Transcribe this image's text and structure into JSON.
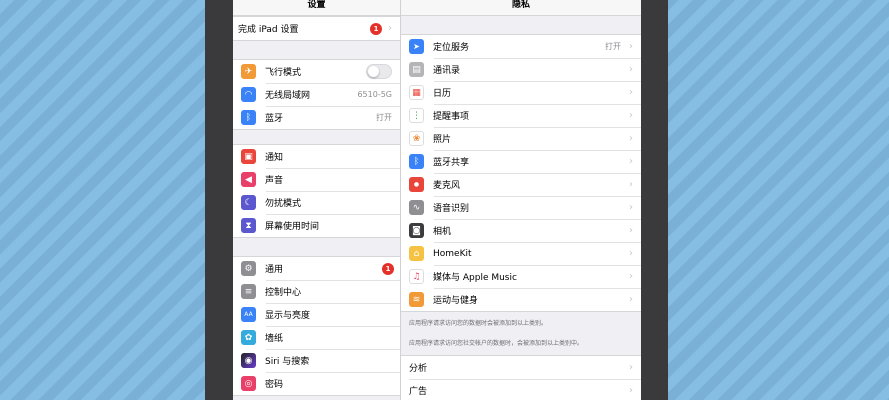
{
  "left_pane": {
    "title": "设置",
    "setup": {
      "label": "完成 iPad 设置",
      "badge": "1"
    },
    "group1": [
      {
        "label": "飞行模式",
        "icon": "airplane-icon",
        "color": "#f19a37",
        "type": "toggle"
      },
      {
        "label": "无线局域网",
        "icon": "wifi-icon",
        "color": "#3a82f7",
        "value": "6510-5G"
      },
      {
        "label": "蓝牙",
        "icon": "bluetooth-icon",
        "color": "#3a82f7",
        "value": "打开"
      }
    ],
    "group2": [
      {
        "label": "通知",
        "icon": "notification-icon",
        "color": "#e9453a"
      },
      {
        "label": "声音",
        "icon": "sound-icon",
        "color": "#e9406a"
      },
      {
        "label": "勿扰模式",
        "icon": "moon-icon",
        "color": "#5b57ce"
      },
      {
        "label": "屏幕使用时间",
        "icon": "hourglass-icon",
        "color": "#5b57ce"
      }
    ],
    "group3": [
      {
        "label": "通用",
        "icon": "gear-icon",
        "color": "#8e8e93",
        "badge": "1"
      },
      {
        "label": "控制中心",
        "icon": "switches-icon",
        "color": "#8e8e93"
      },
      {
        "label": "显示与亮度",
        "icon": "text-size-icon",
        "color": "#3a82f7"
      },
      {
        "label": "墙纸",
        "icon": "flower-icon",
        "color": "#35aadc"
      },
      {
        "label": "Siri 与搜索",
        "icon": "siri-icon",
        "color": "#222222"
      },
      {
        "label": "密码",
        "icon": "fingerprint-icon",
        "color": "#e9406a"
      }
    ]
  },
  "right_pane": {
    "title": "隐私",
    "group1": [
      {
        "label": "定位服务",
        "icon": "location-arrow-icon",
        "color": "#3a82f7",
        "value": "打开"
      },
      {
        "label": "通讯录",
        "icon": "contacts-icon",
        "color": "#b5b5b8"
      },
      {
        "label": "日历",
        "icon": "calendar-icon",
        "color": "#ffffff"
      },
      {
        "label": "提醒事项",
        "icon": "reminders-icon",
        "color": "#ffffff"
      },
      {
        "label": "照片",
        "icon": "photos-icon",
        "color": "#ffffff"
      },
      {
        "label": "蓝牙共享",
        "icon": "bluetooth-icon",
        "color": "#3a82f7"
      },
      {
        "label": "麦克风",
        "icon": "microphone-icon",
        "color": "#e9453a"
      },
      {
        "label": "语音识别",
        "icon": "waveform-icon",
        "color": "#8e8e93"
      },
      {
        "label": "相机",
        "icon": "camera-icon",
        "color": "#3c3c3e"
      },
      {
        "label": "HomeKit",
        "icon": "home-icon",
        "color": "#f6c244"
      },
      {
        "label": "媒体与 Apple Music",
        "icon": "music-note-icon",
        "color": "#ffffff"
      },
      {
        "label": "运动与健身",
        "icon": "fitness-icon",
        "color": "#f19a37"
      }
    ],
    "footnote1": "应用程序请求访问您的数据时会被添加到以上类别。",
    "footnote2": "应用程序请求访问您社交帐户的数据时，会被添加到以上类别中。",
    "group2": [
      {
        "label": "分析"
      },
      {
        "label": "广告"
      }
    ]
  },
  "glyphs": {
    "chevron": "›",
    "airplane": "✈",
    "wifi": "◠",
    "bluetooth": "ᛒ",
    "notification": "▣",
    "sound": "◀",
    "moon": "☾",
    "hourglass": "⧗",
    "gear": "⚙",
    "switches": "≡",
    "text_size": "AA",
    "flower": "✿",
    "siri": "◉",
    "fingerprint": "◎",
    "location": "➤",
    "contacts": "▤",
    "calendar": "▦",
    "reminders": "⋮",
    "photos": "❀",
    "microphone": "●",
    "waveform": "∿",
    "camera": "◙",
    "home": "⌂",
    "music": "♫",
    "fitness": "≋"
  }
}
